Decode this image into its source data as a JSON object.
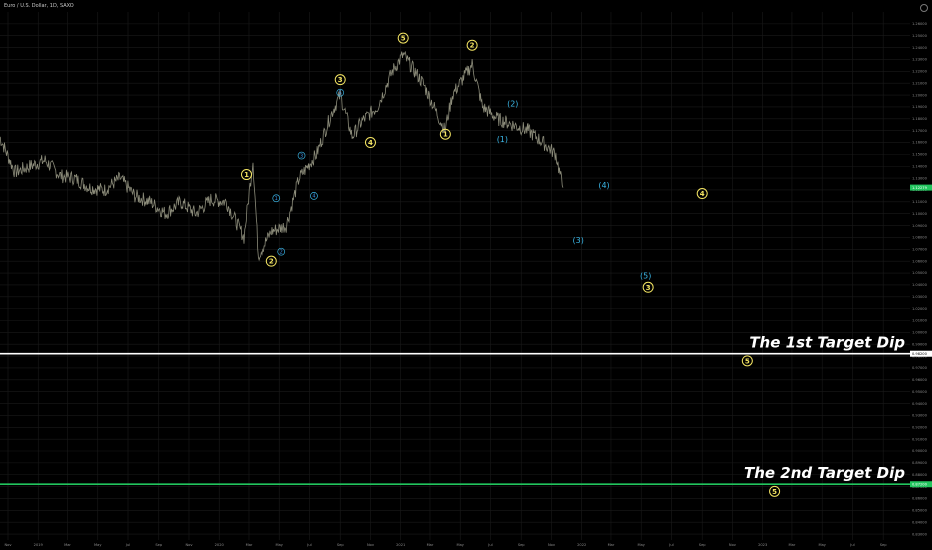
{
  "header": {
    "title": "Euro / U.S. Dollar, 1D, SAXO"
  },
  "colors": {
    "background": "#000000",
    "grid": "#1a1a1a",
    "price_line": "#8c8c7a",
    "wave_yellow": "#f5e663",
    "wave_blue": "#3ab6e6",
    "target1_line": "#ffffff",
    "target2_line": "#22c55e",
    "current_price_tag": "#22c55e"
  },
  "chart_data": {
    "type": "line",
    "title": "Euro / U.S. Dollar, 1D, SAXO",
    "x_ticks": [
      "Nov",
      "2019",
      "Mar",
      "May",
      "Jul",
      "Sep",
      "Nov",
      "2020",
      "Mar",
      "May",
      "Jul",
      "Sep",
      "Nov",
      "2021",
      "Mar",
      "May",
      "Jul",
      "Sep",
      "Nov",
      "2022",
      "Mar",
      "May",
      "Jul",
      "Sep",
      "Nov",
      "2023",
      "Mar",
      "May",
      "Jul",
      "Sep"
    ],
    "ylim": [
      0.825,
      1.27
    ],
    "y_ticks": [
      "1.26000",
      "1.25000",
      "1.24000",
      "1.23000",
      "1.22000",
      "1.21000",
      "1.20000",
      "1.19000",
      "1.18000",
      "1.17000",
      "1.16000",
      "1.15000",
      "1.14000",
      "1.13000",
      "1.12000",
      "1.11000",
      "1.10000",
      "1.09000",
      "1.08000",
      "1.07000",
      "1.06000",
      "1.05000",
      "1.04000",
      "1.03000",
      "1.02000",
      "1.01000",
      "1.00000",
      "0.99000",
      "0.98000",
      "0.97000",
      "0.96000",
      "0.95000",
      "0.94000",
      "0.93000",
      "0.92000",
      "0.91000",
      "0.90000",
      "0.89000",
      "0.88000",
      "0.87000",
      "0.86000",
      "0.85000",
      "0.84000",
      "0.83000"
    ],
    "grid": true,
    "series": [
      {
        "x": [
          "2018-10-15",
          "2018-11-15",
          "2018-12-15",
          "2019-01-15",
          "2019-02-15",
          "2019-03-15",
          "2019-04-15",
          "2019-05-15",
          "2019-06-15",
          "2019-07-15",
          "2019-08-15",
          "2019-09-15",
          "2019-10-15",
          "2019-11-15",
          "2019-12-15",
          "2020-01-15",
          "2020-02-20",
          "2020-03-09",
          "2020-03-20",
          "2020-04-15",
          "2020-05-15",
          "2020-06-10",
          "2020-07-15",
          "2020-08-15",
          "2020-09-01",
          "2020-09-25",
          "2020-10-15",
          "2020-11-15",
          "2020-12-15",
          "2021-01-06",
          "2021-02-15",
          "2021-03-31",
          "2021-04-15",
          "2021-05-25",
          "2021-06-15",
          "2021-07-15",
          "2021-08-15",
          "2021-09-15",
          "2021-10-15",
          "2021-11-10",
          "2021-11-24"
        ],
        "values": [
          1.165,
          1.135,
          1.14,
          1.145,
          1.132,
          1.13,
          1.122,
          1.12,
          1.13,
          1.115,
          1.11,
          1.1,
          1.11,
          1.1,
          1.112,
          1.11,
          1.08,
          1.145,
          1.065,
          1.085,
          1.09,
          1.13,
          1.15,
          1.185,
          1.2,
          1.165,
          1.178,
          1.19,
          1.22,
          1.234,
          1.21,
          1.17,
          1.2,
          1.226,
          1.19,
          1.18,
          1.175,
          1.17,
          1.16,
          1.15,
          1.122
        ]
      }
    ],
    "current_price": "1.12279",
    "target_lines": [
      {
        "label": "The 1st Target Dip",
        "value": 0.982,
        "price_label": "0.98200"
      },
      {
        "label": "The 2nd Target Dip",
        "value": 0.872,
        "price_label": "0.87200"
      }
    ],
    "annotations": [
      {
        "text": "5",
        "style": "yellow",
        "x": "2021-01-06",
        "y": 1.248
      },
      {
        "text": "2",
        "style": "yellow",
        "x": "2021-05-25",
        "y": 1.242
      },
      {
        "text": "3",
        "style": "yellow",
        "x": "2020-09-01",
        "y": 1.213
      },
      {
        "text": "4",
        "style": "yellow",
        "x": "2020-11-01",
        "y": 1.16
      },
      {
        "text": "1",
        "style": "yellow",
        "x": "2021-04-01",
        "y": 1.167
      },
      {
        "text": "1",
        "style": "yellow",
        "x": "2020-02-25",
        "y": 1.133
      },
      {
        "text": "2",
        "style": "yellow",
        "x": "2020-04-15",
        "y": 1.06
      },
      {
        "text": "4",
        "style": "yellow",
        "x": "2022-09-01",
        "y": 1.117
      },
      {
        "text": "3",
        "style": "yellow",
        "x": "2022-05-15",
        "y": 1.038
      },
      {
        "text": "5",
        "style": "yellow",
        "x": "2022-12-01",
        "y": 0.976
      },
      {
        "text": "5",
        "style": "yellow",
        "x": "2023-01-25",
        "y": 0.866
      },
      {
        "text": "(2)",
        "style": "blue",
        "x": "2021-08-15",
        "y": 1.193
      },
      {
        "text": "(1)",
        "style": "blue",
        "x": "2021-07-25",
        "y": 1.163
      },
      {
        "text": "(4)",
        "style": "blue",
        "x": "2022-02-15",
        "y": 1.124
      },
      {
        "text": "(3)",
        "style": "blue",
        "x": "2021-12-25",
        "y": 1.078
      },
      {
        "text": "(5)",
        "style": "blue",
        "x": "2022-05-10",
        "y": 1.048
      },
      {
        "text": "(1)",
        "style": "blue-small",
        "x": "2020-04-25",
        "y": 1.113
      },
      {
        "text": "(2)",
        "style": "blue-small",
        "x": "2020-05-05",
        "y": 1.068
      },
      {
        "text": "(3)",
        "style": "blue-small",
        "x": "2020-06-15",
        "y": 1.149
      },
      {
        "text": "(4)",
        "style": "blue-small",
        "x": "2020-07-10",
        "y": 1.115
      },
      {
        "text": "(5)",
        "style": "blue-small",
        "x": "2020-09-01",
        "y": 1.202
      }
    ]
  }
}
